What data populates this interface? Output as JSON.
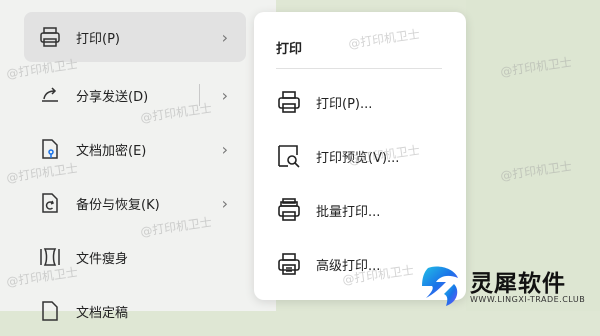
{
  "file_menu": {
    "items": [
      {
        "label": "打印(P)",
        "icon": "printer-icon",
        "has_submenu": true,
        "active": true
      },
      {
        "label": "分享发送(D)",
        "icon": "share-arrow-icon",
        "has_submenu": true
      },
      {
        "label": "文档加密(E)",
        "icon": "document-lock-icon",
        "has_submenu": true
      },
      {
        "label": "备份与恢复(K)",
        "icon": "backup-restore-icon",
        "has_submenu": true
      },
      {
        "label": "文件瘦身",
        "icon": "file-slim-icon",
        "has_submenu": false
      },
      {
        "label": "文档定稿",
        "icon": "document-finalize-icon",
        "has_submenu": false
      }
    ]
  },
  "submenu": {
    "title": "打印",
    "items": [
      {
        "label": "打印(P)...",
        "icon": "printer-icon"
      },
      {
        "label": "打印预览(V)...",
        "icon": "print-preview-icon"
      },
      {
        "label": "批量打印...",
        "icon": "batch-print-icon"
      },
      {
        "label": "高级打印...",
        "icon": "advanced-print-icon"
      }
    ]
  },
  "watermark": "@打印机卫士",
  "logo": {
    "name": "灵犀软件",
    "url": "WWW.LINGXI-TRADE.CLUB",
    "colors": {
      "blue": "#1a73e8",
      "cyan": "#22c1e6",
      "purple": "#7b4dff"
    }
  }
}
